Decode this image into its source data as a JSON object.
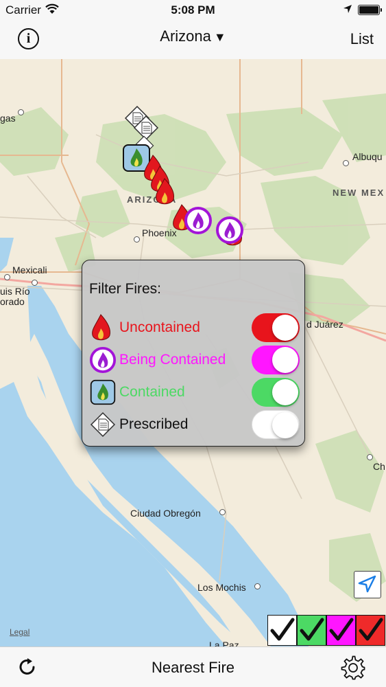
{
  "status_bar": {
    "carrier": "Carrier",
    "time": "5:08 PM"
  },
  "nav": {
    "title": "Arizona",
    "title_indicator": "▼",
    "info_label": "i",
    "list_label": "List"
  },
  "map": {
    "place_labels": [
      "gas",
      "Albuqu",
      "NEW MEX",
      "ARIZONA",
      "Phoenix",
      "Mexicali",
      "uis Río",
      "orado",
      "d Juárez",
      "Ch",
      "Ciudad Obregón",
      "Los Mochis",
      "La Paz"
    ],
    "legal_label": "Legal"
  },
  "filter": {
    "title": "Filter Fires:",
    "items": [
      {
        "label": "Uncontained",
        "color": "#e8141c",
        "on": true,
        "icon": "red-flame-icon"
      },
      {
        "label": "Being Contained",
        "color": "#ff16ff",
        "on": true,
        "icon": "purple-circle-flame-icon"
      },
      {
        "label": "Contained",
        "color": "#4cd964",
        "on": true,
        "icon": "green-flame-icon"
      },
      {
        "label": "Prescribed",
        "color": "#111111",
        "on": false,
        "icon": "prescribed-document-icon"
      }
    ]
  },
  "check_strip": {
    "colors": [
      "#ffffff",
      "#4cd964",
      "#ff16ff",
      "#ef2a2a"
    ]
  },
  "toolbar": {
    "nearest_label": "Nearest Fire"
  }
}
